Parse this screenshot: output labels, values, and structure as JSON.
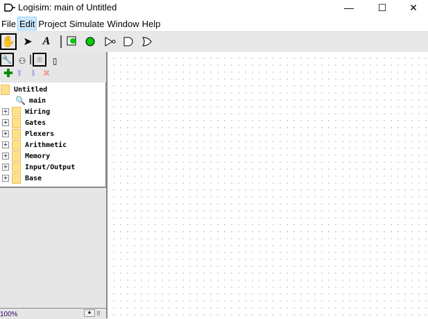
{
  "window": {
    "title": "Logisim: main of Untitled",
    "minimize": "—",
    "maximize": "☐",
    "close": "✕"
  },
  "menu": [
    "File",
    "Edit",
    "Project",
    "Simulate",
    "Window",
    "Help"
  ],
  "toolbar": {
    "text_tool": "A"
  },
  "explorer": {
    "root": "Untitled",
    "circuit": "main",
    "libraries": [
      "Wiring",
      "Gates",
      "Plexers",
      "Arithmetic",
      "Memory",
      "Input/Output",
      "Base"
    ]
  },
  "zoom_level": "100%"
}
